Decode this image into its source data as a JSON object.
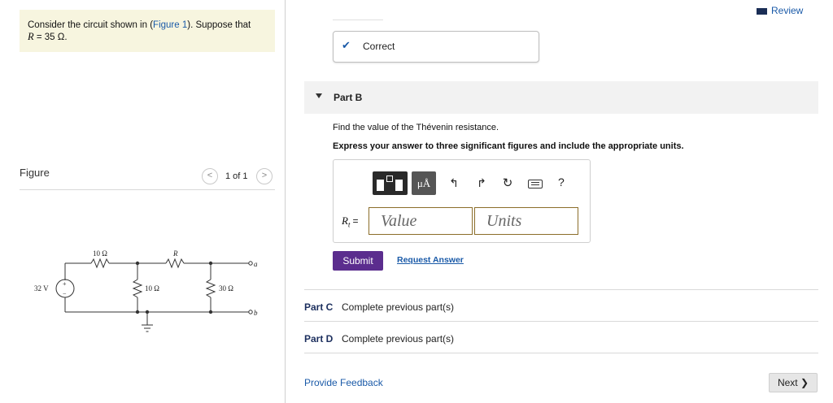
{
  "problem": {
    "text_before": "Consider the circuit shown in (",
    "figure_link": "Figure 1",
    "text_after": "). Suppose that",
    "r_var": "R",
    "r_value": " = 35 Ω."
  },
  "figure": {
    "label": "Figure",
    "counter": "1 of 1",
    "prev_icon": "chevron-left",
    "next_icon": "chevron-right",
    "circuit": {
      "source": "32 V",
      "source_plus": "+",
      "source_minus": "−",
      "r_top1": "10 Ω",
      "r_top2": "R",
      "r_mid": "10 Ω",
      "r_right": "30 Ω",
      "terminal_a": "a",
      "terminal_b": "b"
    }
  },
  "header": {
    "review_label": "Review"
  },
  "part_a": {
    "status_label": "Correct"
  },
  "part_b": {
    "title": "Part B",
    "question": "Find the value of the Thévenin resistance.",
    "instructions": "Express your answer to three significant figures and include the appropriate units.",
    "toolbar": {
      "units_label": "μÅ",
      "undo_icon": "↰",
      "redo_icon": "↱",
      "reset_icon": "↻",
      "help_label": "?"
    },
    "answer_label_var": "R",
    "answer_label_sub": "t",
    "answer_label_eq": " =",
    "value_placeholder": "Value",
    "units_placeholder": "Units",
    "submit_label": "Submit",
    "request_label": "Request Answer"
  },
  "part_c": {
    "label": "Part C",
    "status": "Complete previous part(s)"
  },
  "part_d": {
    "label": "Part D",
    "status": "Complete previous part(s)"
  },
  "footer": {
    "feedback_label": "Provide Feedback",
    "next_label": "Next ❯"
  },
  "colors": {
    "link": "#1a5aa8",
    "submit": "#5b2d8e",
    "problem_bg": "#f7f5df",
    "field_border": "#8b6d2a"
  }
}
